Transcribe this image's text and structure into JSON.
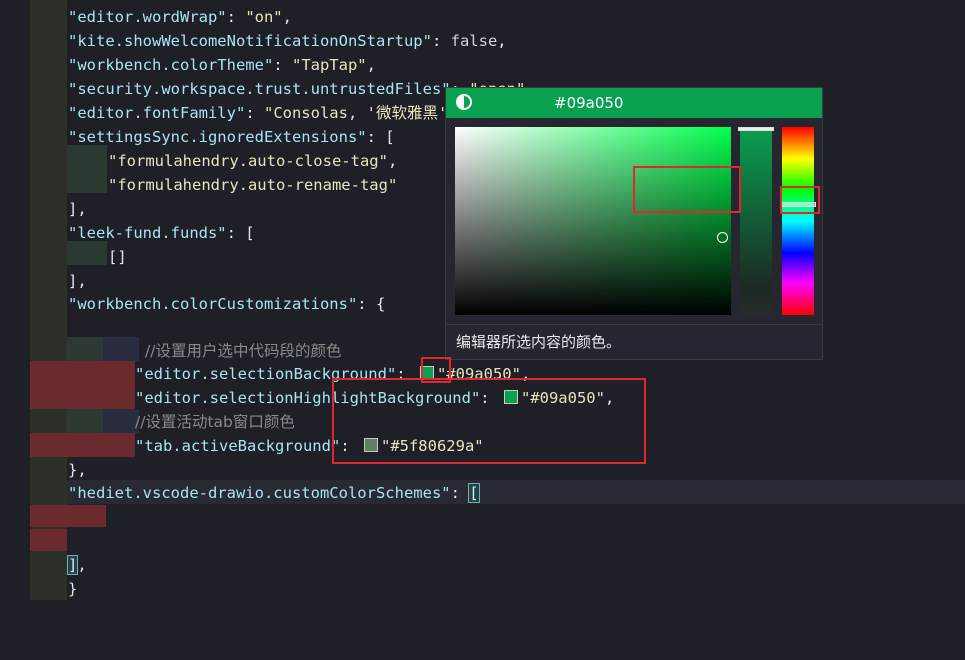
{
  "editor": {
    "lines": {
      "l1_key": "\"editor.wordWrap\"",
      "l1_val": "\"on\"",
      "l2_key": "\"kite.showWelcomeNotificationOnStartup\"",
      "l2_val": "false",
      "l3_key": "\"workbench.colorTheme\"",
      "l3_val": "\"TapTap\"",
      "l4_key": "\"security.workspace.trust.untrustedFiles\"",
      "l4_val": "\"open\"",
      "l5_key": "\"editor.fontFamily\"",
      "l5_val": "\"Consolas, '微软雅黑'\"",
      "l6_key": "\"settingsSync.ignoredExtensions\"",
      "l7_val": "\"formulahendry.auto-close-tag\"",
      "l8_val": "\"formulahendry.auto-rename-tag\"",
      "l10_key": "\"leek-fund.funds\"",
      "l11_val": "[]",
      "l13_key": "\"workbench.colorCustomizations\"",
      "l15_comment": "//设置用户选中代码段的颜色",
      "l16_key": "\"editor.selectionBackground\"",
      "l16_val": "\"#09a050\"",
      "l17_key": "\"editor.selectionHighlightBackground\"",
      "l17_val": "\"#09a050\"",
      "l18_comment": "//设置活动tab窗口颜色",
      "l19_key": "\"tab.activeBackground\"",
      "l19_val": "\"#5f80629a\"",
      "l21_key": "\"hediet.vscode-drawio.customColorSchemes\""
    },
    "colors": {
      "selection_swatch": "#09a050",
      "highlight_swatch": "#09a050",
      "tab_swatch": "#5f8062"
    }
  },
  "color_picker": {
    "hex": "#09a050",
    "description": "编辑器所选内容的颜色。",
    "contrast_icon": "contrast-icon"
  }
}
